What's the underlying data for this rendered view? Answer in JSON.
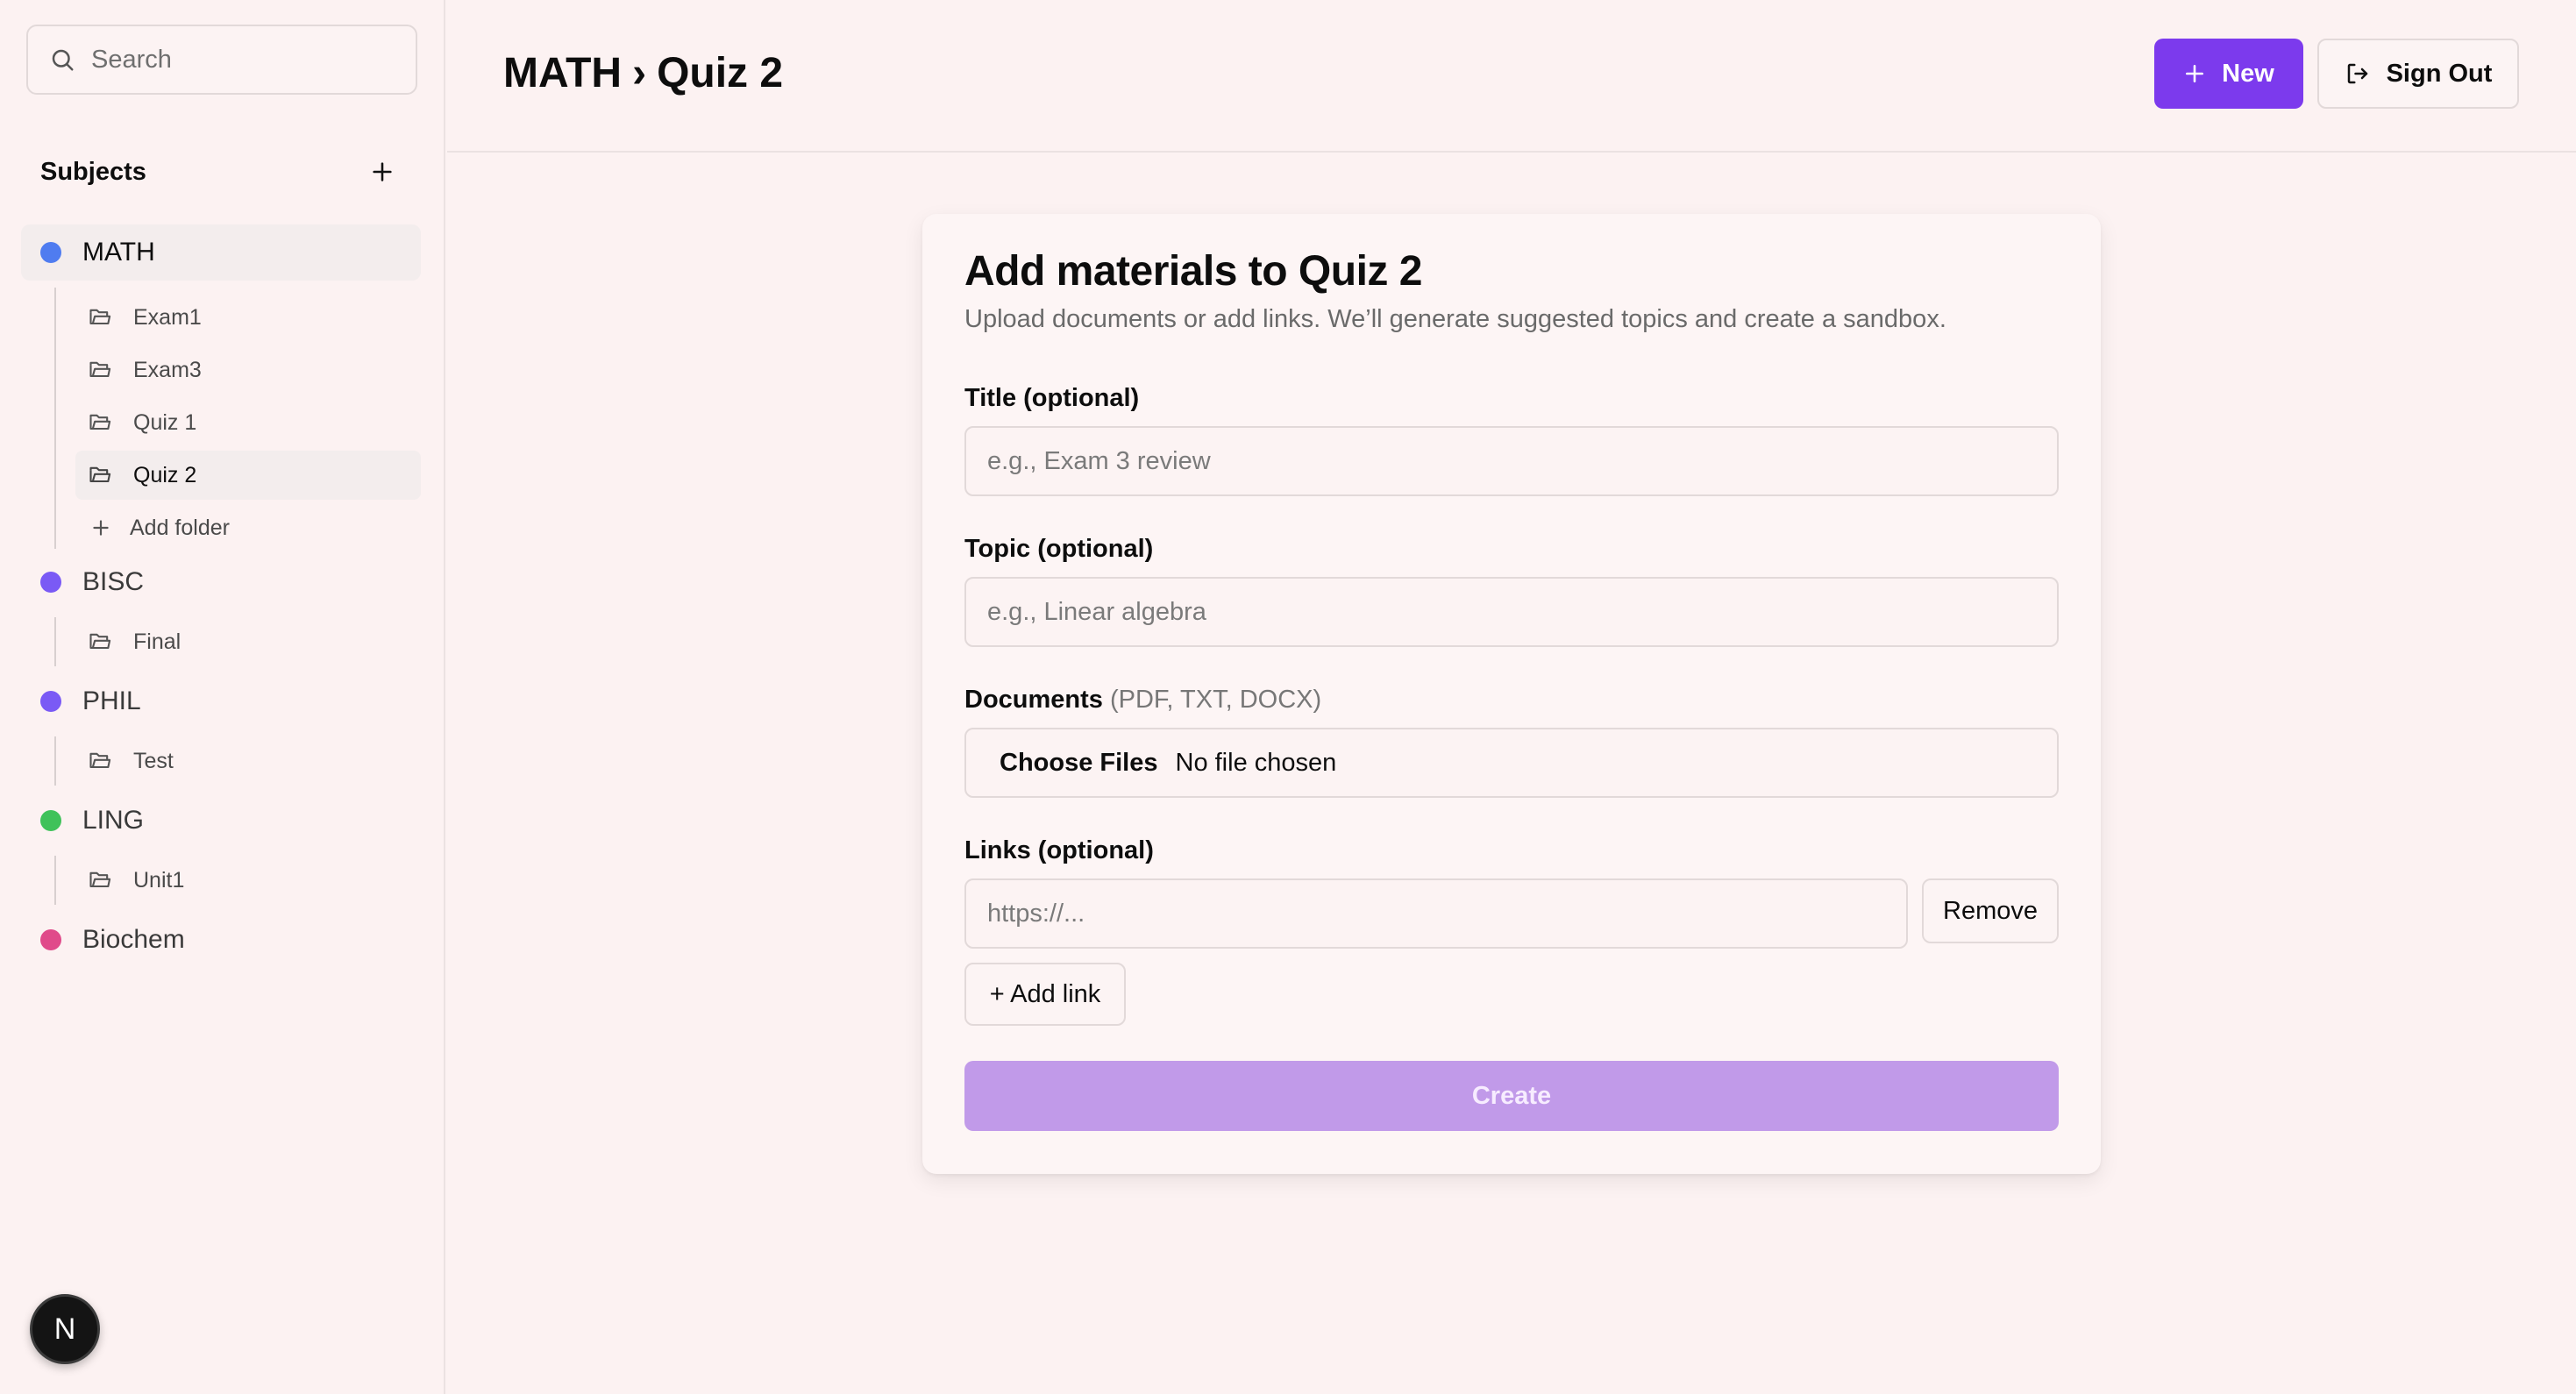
{
  "sidebar": {
    "search_placeholder": "Search",
    "subjects_title": "Subjects",
    "subjects": [
      {
        "name": "MATH",
        "color": "#4f7cf0",
        "folders": [
          "Exam1",
          "Exam3",
          "Quiz 1",
          "Quiz 2"
        ],
        "add_folder_label": "Add folder"
      },
      {
        "name": "BISC",
        "color": "#7a5af5",
        "folders": [
          "Final"
        ]
      },
      {
        "name": "PHIL",
        "color": "#7a5af5",
        "folders": [
          "Test"
        ]
      },
      {
        "name": "LING",
        "color": "#3fc25a",
        "folders": [
          "Unit1"
        ]
      },
      {
        "name": "Biochem",
        "color": "#e04a8a",
        "folders": []
      }
    ],
    "active_subject": "MATH",
    "active_folder": "Quiz 2",
    "avatar_initial": "N"
  },
  "header": {
    "breadcrumb_subject": "MATH",
    "breadcrumb_separator": "›",
    "breadcrumb_folder": "Quiz 2",
    "new_label": "New",
    "sign_out_label": "Sign Out",
    "accent": "#7c3aed"
  },
  "form": {
    "title": "Add materials to Quiz 2",
    "subtitle": "Upload documents or add links. We’ll generate suggested topics and create a sandbox.",
    "title_label": "Title (optional)",
    "title_placeholder": "e.g., Exam 3 review",
    "topic_label": "Topic (optional)",
    "topic_placeholder": "e.g., Linear algebra",
    "documents_label": "Documents",
    "documents_formats": "(PDF, TXT, DOCX)",
    "choose_files_label": "Choose Files",
    "file_status": "No file chosen",
    "links_label": "Links (optional)",
    "link_placeholder": "https://...",
    "remove_label": "Remove",
    "add_link_label": "+ Add link",
    "create_label": "Create"
  }
}
